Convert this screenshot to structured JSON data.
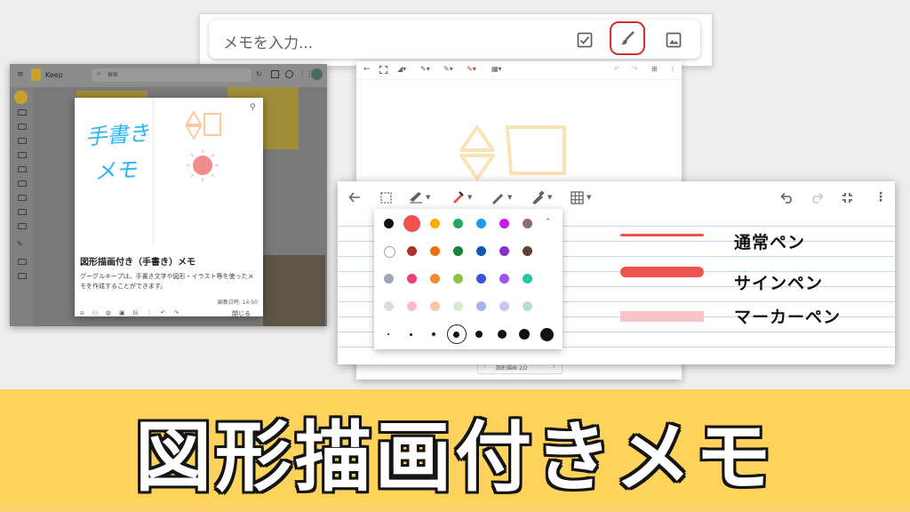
{
  "topbar": {
    "placeholder": "メモを入力...",
    "icons": [
      "checkbox-icon",
      "brush-icon",
      "image-icon"
    ]
  },
  "keep": {
    "app_name": "Keep",
    "search_label": "検索",
    "note": {
      "title": "図形描画付き（手書き）メモ",
      "description": "グーグルキープは、手書き文字や図形・イラスト等を使ったメモを作成することができます。",
      "edited": "編集日時: 14:50",
      "close_label": "閉じる",
      "handwriting": [
        "手書き",
        "メモ"
      ]
    }
  },
  "drawing_back": {
    "pager": "図形描画 2/2"
  },
  "pens": [
    {
      "label": "通常ペン",
      "color": "#ef5350"
    },
    {
      "label": "サインペン",
      "color": "#ef5350"
    },
    {
      "label": "マーカーペン",
      "color": "#f8c6c8"
    }
  ],
  "palette": {
    "rows": [
      [
        "#111111",
        "#ef5350",
        "#f9ab00",
        "#1bab5a",
        "#1a9cf0",
        "#c51ce8",
        "#8d6e63"
      ],
      [
        "#ffffff",
        "#a8322d",
        "#e8710a",
        "#188038",
        "#1558b0",
        "#8430ce",
        "#5d4037"
      ],
      [
        "#9aa8b4",
        "#ec407a",
        "#f28b33",
        "#8bc34a",
        "#3f51e5",
        "#9c55f0",
        "#26c6aa"
      ],
      [
        "#dadce0",
        "#f8bbd0",
        "#f8c7a8",
        "#d5eec9",
        "#a8b2f0",
        "#d0c1f5",
        "#b2dfdb"
      ]
    ],
    "selected_color": "#ef5350",
    "stroke_sizes": [
      2,
      3,
      4,
      7,
      8,
      10,
      12,
      15
    ]
  },
  "banner": {
    "title": "図形描画付きメモ",
    "bg": "#fdd35b"
  }
}
